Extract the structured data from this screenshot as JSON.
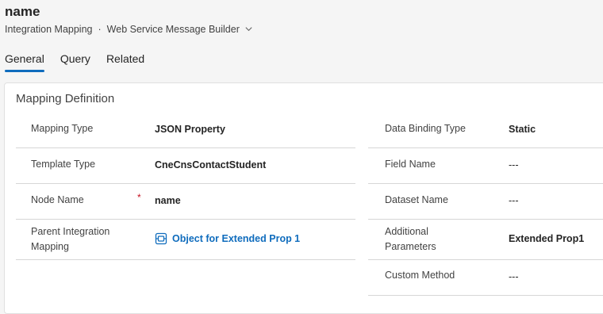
{
  "record": {
    "title": "name",
    "entity": "Integration Mapping",
    "separator": "·",
    "form": "Web Service Message Builder"
  },
  "tabs": [
    "General",
    "Query",
    "Related"
  ],
  "section": {
    "title": "Mapping Definition",
    "left": [
      {
        "label": "Mapping Type",
        "value": "JSON Property"
      },
      {
        "label": "Template Type",
        "value": "CneCnsContactStudent"
      },
      {
        "label": "Node Name",
        "required": "*",
        "value": "name"
      },
      {
        "label": "Parent Integration Mapping",
        "value": "Object for Extended Prop 1"
      }
    ],
    "right": [
      {
        "label": "Data Binding Type",
        "value": "Static"
      },
      {
        "label": "Field Name",
        "value": "---"
      },
      {
        "label": "Dataset Name",
        "value": "---"
      },
      {
        "label": "Additional Parameters",
        "value": "Extended Prop1"
      },
      {
        "label": "Custom Method",
        "value": "---"
      }
    ]
  },
  "colors": {
    "accent": "#0f6cbd",
    "required": "#c50f1f"
  },
  "icons": {
    "lookup": "entity-record-icon",
    "form_switcher": "chevron-down-icon"
  }
}
